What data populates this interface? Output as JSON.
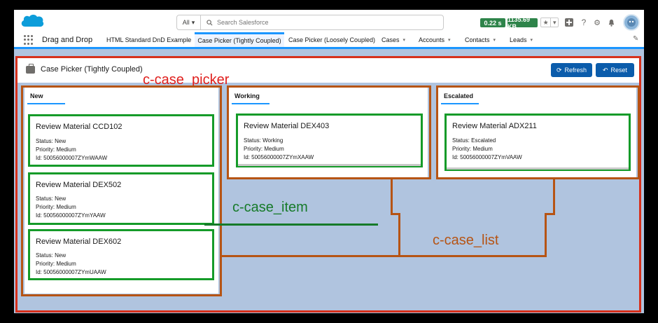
{
  "header": {
    "search": {
      "scope": "All",
      "placeholder": "Search Salesforce"
    },
    "perf": {
      "time": "0.22 s",
      "size": "1135.69 KB"
    },
    "icons": [
      "star-icon",
      "plus-icon",
      "help-icon",
      "setup-icon",
      "bell-icon",
      "avatar"
    ]
  },
  "nav": {
    "app_name": "Drag and Drop",
    "items": [
      {
        "label": "HTML Standard DnD Example",
        "dropdown": false,
        "active": false
      },
      {
        "label": "Case Picker (Tightly Coupled)",
        "dropdown": false,
        "active": true
      },
      {
        "label": "Case Picker (Loosely Coupled)",
        "dropdown": false,
        "active": false
      },
      {
        "label": "Cases",
        "dropdown": true,
        "active": false
      },
      {
        "label": "Accounts",
        "dropdown": true,
        "active": false
      },
      {
        "label": "Contacts",
        "dropdown": true,
        "active": false
      },
      {
        "label": "Leads",
        "dropdown": true,
        "active": false
      }
    ]
  },
  "picker": {
    "title": "Case Picker (Tightly Coupled)",
    "refresh_label": "Refresh",
    "reset_label": "Reset"
  },
  "columns": [
    {
      "title": "New",
      "cases": [
        {
          "title": "Review Material CCD102",
          "status": "Status: New",
          "priority": "Priority: Medium",
          "id": "Id: 50056000007ZYmWAAW"
        },
        {
          "title": "Review Material DEX502",
          "status": "Status: New",
          "priority": "Priority: Medium",
          "id": "Id: 50056000007ZYmYAAW"
        },
        {
          "title": "Review Material DEX602",
          "status": "Status: New",
          "priority": "Priority: Medium",
          "id": "Id: 50056000007ZYmUAAW"
        }
      ]
    },
    {
      "title": "Working",
      "cases": [
        {
          "title": "Review Material DEX403",
          "status": "Status: Working",
          "priority": "Priority: Medium",
          "id": "Id: 50056000007ZYmXAAW"
        }
      ]
    },
    {
      "title": "Escalated",
      "cases": [
        {
          "title": "Review Material ADX211",
          "status": "Status: Escalated",
          "priority": "Priority: Medium",
          "id": "Id: 50056000007ZYmVAAW"
        }
      ]
    }
  ],
  "annotations": {
    "case_picker": "c-case_picker",
    "case_item": "c-case_item",
    "case_list": "c-case_list"
  },
  "colors": {
    "picker_annotation": "#d7301b",
    "list_annotation": "#b65414",
    "item_annotation": "#159b29",
    "brand_blue": "#0b5cab",
    "canvas": "#b0c4df"
  }
}
